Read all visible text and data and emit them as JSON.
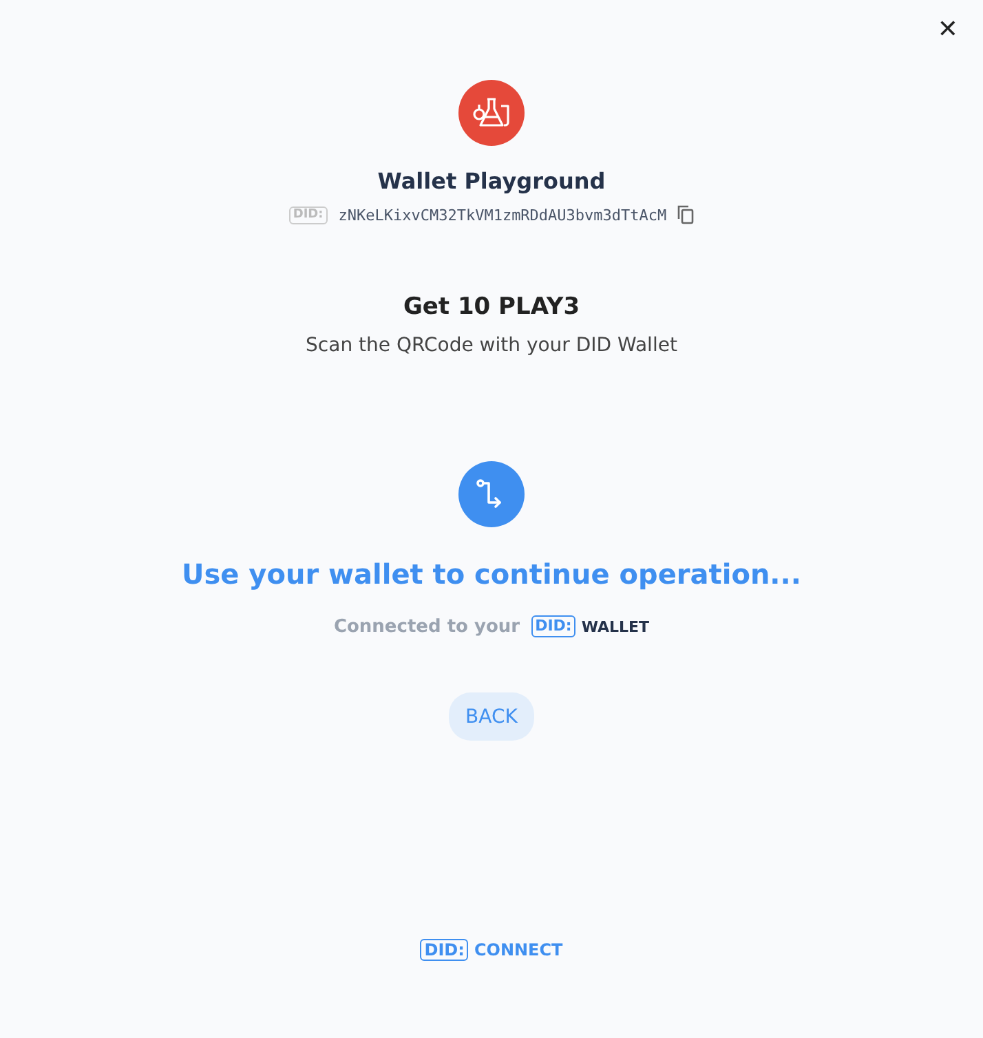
{
  "close": "✕",
  "app": {
    "name": "Wallet Playground",
    "did_badge": "DID:",
    "did": "zNKeLKixvCM32TkVM1zmRDdAU3bvm3dTtAcM"
  },
  "request": {
    "title": "Get 10 PLAY3",
    "subtitle": "Scan the QRCode with your DID Wallet"
  },
  "status": {
    "heading": "Use your wallet to continue operation...",
    "connected_text": "Connected to your",
    "badge": "DID:",
    "wallet": "WALLET"
  },
  "buttons": [
    "BACK"
  ],
  "footer": {
    "badge": "DID:",
    "label": "CONNECT"
  }
}
